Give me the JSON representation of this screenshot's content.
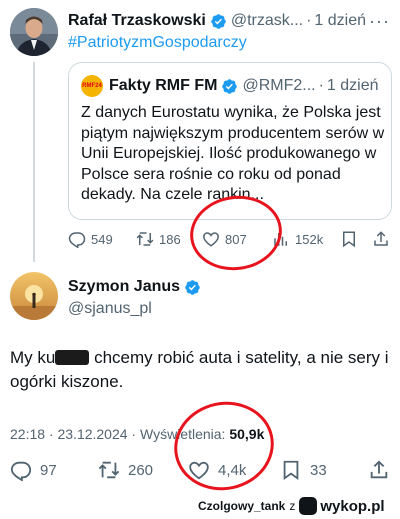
{
  "top_tweet": {
    "author_name": "Rafał Trzaskowski",
    "handle": "@trzask...",
    "separator": "·",
    "time": "1 dzień",
    "hashtag": "#PatriotyzmGospodarczy",
    "quote": {
      "logo_text": "RMF24",
      "author_name": "Fakty RMF FM",
      "handle": "@RMF2...",
      "separator": "·",
      "time": "1 dzień",
      "text": "Z danych Eurostatu wynika, że Polska jest piątym największym producentem serów w Unii Europejskiej. Ilość produkowanego w Polsce sera rośnie co roku od ponad dekady. Na czele rankin..."
    },
    "stats": {
      "replies": "549",
      "reposts": "186",
      "likes": "807",
      "views": "152k"
    }
  },
  "main_tweet": {
    "author_name": "Szymon Janus",
    "handle": "@sjanus_pl",
    "text_before": "My ku",
    "text_after": " chcemy robić auta i satelity, a nie sery i ogórki kiszone.",
    "meta_prefix": "22:18 · 23.12.2024 · Wyświetlenia: ",
    "views": "50,9k",
    "stats": {
      "replies": "97",
      "reposts": "260",
      "likes": "4,4k",
      "bookmarks": "33"
    }
  },
  "footer": {
    "user": "Czolgowy_tank",
    "z": "z",
    "site": "wykop.pl"
  },
  "colors": {
    "link_blue": "#1d9bf0",
    "secondary_text": "#536471",
    "highlight_red": "#e8141d"
  }
}
